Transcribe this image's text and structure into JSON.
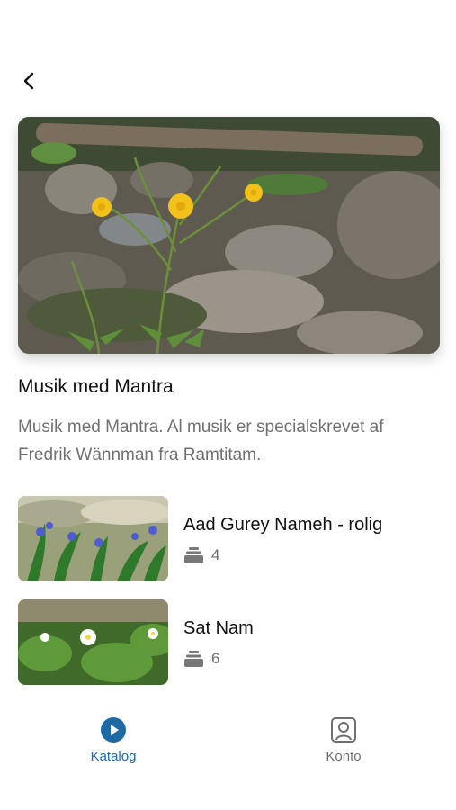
{
  "header": {
    "back_icon": "chevron-left-icon"
  },
  "album": {
    "title": "Musik med Mantra",
    "description": "Musik med Mantra. Al musik er specialskrevet af Fredrik Wännman fra Ramtitam."
  },
  "tracks": [
    {
      "title": "Aad Gurey Nameh - rolig",
      "count": "4",
      "icon": "stack-icon"
    },
    {
      "title": "Sat Nam",
      "count": "6",
      "icon": "stack-icon"
    }
  ],
  "nav": {
    "katalog": {
      "label": "Katalog",
      "icon": "play-circle-icon",
      "active": true
    },
    "konto": {
      "label": "Konto",
      "icon": "user-square-icon",
      "active": false
    }
  },
  "colors": {
    "accent": "#1f6aa5",
    "muted_text": "#707070"
  }
}
